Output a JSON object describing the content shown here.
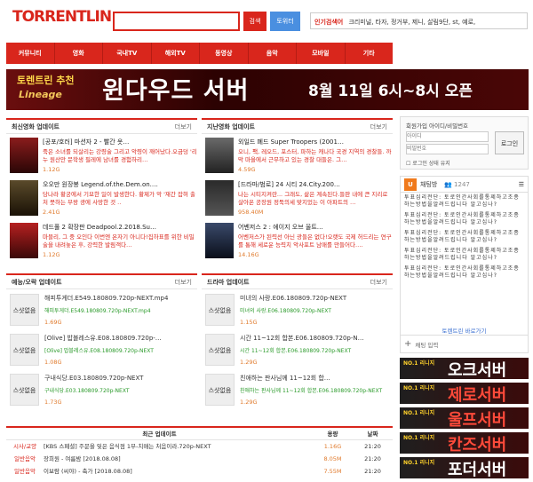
{
  "header": {
    "logo": "TORRENTLIN",
    "search_button": "검색",
    "torrent_button": "토위터",
    "popular_label": "인기검색어",
    "popular_terms": "크리미널, 타자, 정거부, 제니, 살림9단, st, 예로,"
  },
  "nav": {
    "items": [
      "커뮤니티",
      "영화",
      "국내TV",
      "해외TV",
      "동영상",
      "음악",
      "모바일",
      "기타"
    ]
  },
  "banner": {
    "line1": "토렌트린 추천",
    "line2": "Lineage",
    "line3": "윈다우드 서버",
    "line4": "8월 11일 6시~8시 오픈"
  },
  "latest_movies": {
    "title": "최신영화 업데이트",
    "more": "더보기",
    "items": [
      {
        "title": "[공포/호러] 마션자 2 - 빨간 옷…",
        "desc": "죽은 소녀를 되살리는 강령술 그리고 악령이 깨어났다.오금덩 '리누 원산만 문학생 필레에 남녀를 경험하리…",
        "size": "1.12G"
      },
      {
        "title": "오오만 원장봉 Legend.of.the.Dem.on.…",
        "desc": "당나라 황궁에서 기묘한 일이 발생한다.  황제가 악 '재간 잡혀 출처 뭇하는 부왕 광에 사망한 것 ..",
        "size": "2.41G"
      },
      {
        "title": "데드풀 2 확장판 Deadpool.2.2018.Su…",
        "desc": "마블리, 그 중 오인다 이번엔 온자기 아니다!집하표를 위한 비밀 술을 내려놓은 후, 강력한 발림객다…",
        "size": "1.12G"
      }
    ]
  },
  "previous_movies": {
    "title": "지난영화 업데이트",
    "more": "더보기",
    "items": [
      {
        "title": "외일드 폐드 Super Troopers (2001…",
        "desc": "오니, 팩, 레오드, 포스터, 파하는 캐나다 국경 지역의 경찰들. 까막 마을에서 근무하고 있는 경찰 대들은. 그…",
        "size": "4.59G"
      },
      {
        "title": "[드라마/범로] 24 시티 24.City.200…",
        "desc": "나는 시티지켜란... 그래도, 삶은 계속된다.들판 내에 큰 지리로 살아온 공장원 정둑의세 맞지었는 이 아파트의 …",
        "size": "958.40M"
      },
      {
        "title": "어벤저스 2 : 에이지 오브 울트…",
        "desc": "어벤저스가 된력선 아닌 광들은 없다!오랫도 국제 허드리는 연구를 통해 세로운 능력치 악사포트 남매를 만들어다.…",
        "size": "14.16G"
      }
    ]
  },
  "variety": {
    "title": "예능/오락 업데이트",
    "more": "더보기",
    "noshot": "스샷없음",
    "items": [
      {
        "title": "해피투게더.E549.180809.720p-NEXT.mp4",
        "sub": "해피투게더.E549.180809.720p-NEXT.mp4",
        "size": "1.69G"
      },
      {
        "title": "[Olive] 밥블레스유.E08.180809.720p-…",
        "sub": "[Olive] 밥블레스유.E08.180809.720p-NEXT",
        "size": "1.08G"
      },
      {
        "title": "구내식당.E03.180809.720p-NEXT",
        "sub": "구내식당.E03.180809.720p-NEXT",
        "size": "1.73G"
      }
    ]
  },
  "drama": {
    "title": "드라마 업데이트",
    "more": "더보기",
    "noshot": "스샷없음",
    "items": [
      {
        "title": "미녀의 사랑.E06.180809.720p-NEXT",
        "sub": "미녀의 사랑.E06.180809.720p-NEXT",
        "size": "1.15G"
      },
      {
        "title": "시간 11~12회 합본.E06.180809.720p-N…",
        "sub": "시간 11~12회 합본.E06.180809.720p-NEXT",
        "size": "1.29G"
      },
      {
        "title": "친애하는 판사님께 11~12회 합…",
        "sub": "친애하는 판사님께 11~12회 합본.E06.180809.720p-NEXT",
        "size": "1.29G"
      }
    ]
  },
  "recent": {
    "title": "최근 업데이트",
    "col_size": "용량",
    "col_date": "날짜",
    "rows": [
      {
        "cat": "시사/교양",
        "title": "[KBS 스페셜] 주문을 잊은 음식점 1부-치매는 처음이라.720p-NEXT",
        "size": "1.16G",
        "date": "21:20"
      },
      {
        "cat": "일반음악",
        "title": "장희원 - 여름밤 [2018.08.08]",
        "size": "8.05M",
        "date": "21:20"
      },
      {
        "cat": "일반음악",
        "title": "이보람 (씨야) - 축가 [2018.08.08]",
        "size": "7.55M",
        "date": "21:20"
      }
    ]
  },
  "login": {
    "links": "회원가입 아이디/비밀번호",
    "id_placeholder": "아이디",
    "pw_placeholder": "비밀번호",
    "button": "로그인",
    "keep": "로그인 상태 유지"
  },
  "chat": {
    "title": "채팅방",
    "count": "1247",
    "messages": [
      "투표심리전단: 토로인간사회를통제하고조종하는방법을알려드립니다 알고십나?",
      "투표심리전단: 토로인간사회를통제하고조종하는방법을알려드립니다 알고십나?",
      "투표심리전단: 토로인간사회를통제하고조종하는방법을알려드립니다 알고십나?",
      "투표심리전단: 토로인간사회를통제하고조종하는방법을알려드립니다 알고십나?",
      "투표심리전단: 토로인간사회를통제하고조종하는방법을알려드립니다 알고십나?"
    ],
    "link": "토렌트린 바로가기",
    "input": "채팅 입력"
  },
  "ads": [
    {
      "small": "NO.1 리니지",
      "big": "오크서버"
    },
    {
      "small": "NO.1 리니지",
      "big": "제로서버"
    },
    {
      "small": "NO.1 리니지",
      "big": "울프서버"
    },
    {
      "small": "NO.1 리니지",
      "big": "칸즈서버"
    },
    {
      "small": "NO.1 리니지",
      "big": "포더서버"
    }
  ]
}
